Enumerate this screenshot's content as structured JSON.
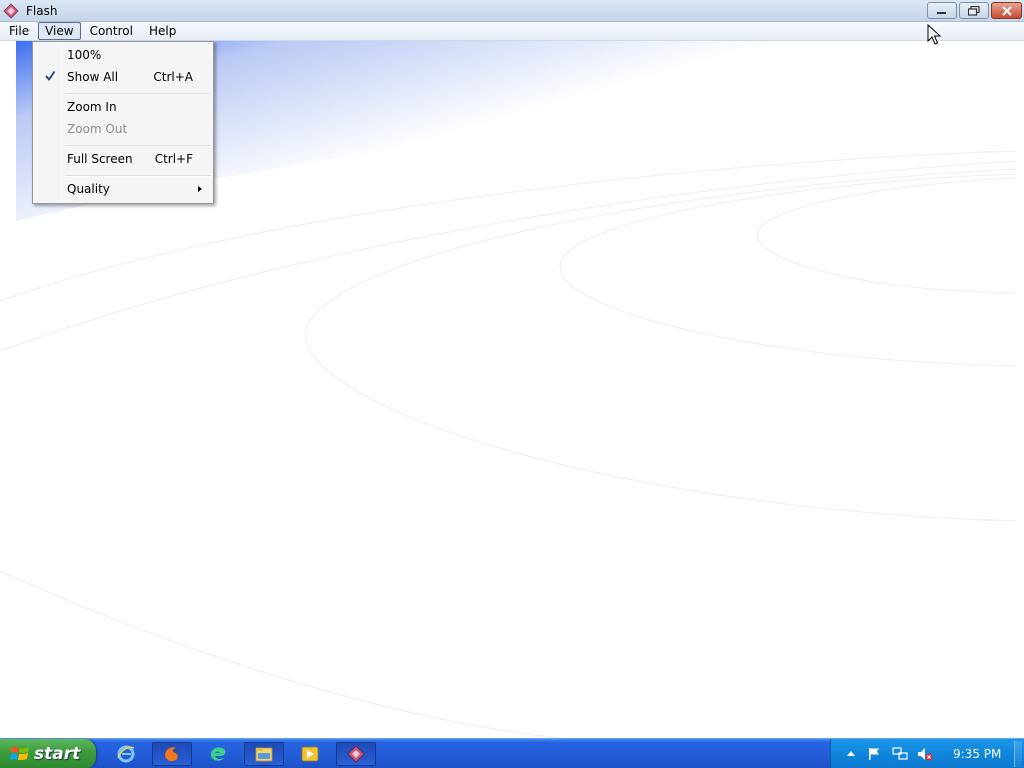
{
  "window": {
    "title": "Flash"
  },
  "menubar": {
    "items": [
      {
        "label": "File",
        "active": false
      },
      {
        "label": "View",
        "active": true
      },
      {
        "label": "Control",
        "active": false
      },
      {
        "label": "Help",
        "active": false
      }
    ]
  },
  "view_menu": {
    "items": [
      {
        "label": "100%",
        "shortcut": "",
        "checked": false,
        "disabled": false
      },
      {
        "label": "Show All",
        "shortcut": "Ctrl+A",
        "checked": true,
        "disabled": false
      },
      {
        "label": "Zoom In",
        "shortcut": "",
        "checked": false,
        "disabled": false
      },
      {
        "label": "Zoom Out",
        "shortcut": "",
        "checked": false,
        "disabled": true
      },
      {
        "label": "Full Screen",
        "shortcut": "Ctrl+F",
        "checked": false,
        "disabled": false
      },
      {
        "label": "Quality",
        "shortcut": "",
        "checked": false,
        "disabled": false,
        "submenu": true
      }
    ]
  },
  "taskbar": {
    "start_label": "start",
    "clock": "9:35 PM",
    "quick_launch": [
      "internet-explorer-icon",
      "firefox-icon",
      "edge-icon",
      "file-explorer-icon",
      "media-player-icon",
      "flash-player-icon"
    ]
  },
  "colors": {
    "taskbar_blue": "#245edb",
    "start_green": "#3c9a3c",
    "tray_blue": "#0f86dc",
    "content_gradient_blue": "#3e6ff0"
  }
}
